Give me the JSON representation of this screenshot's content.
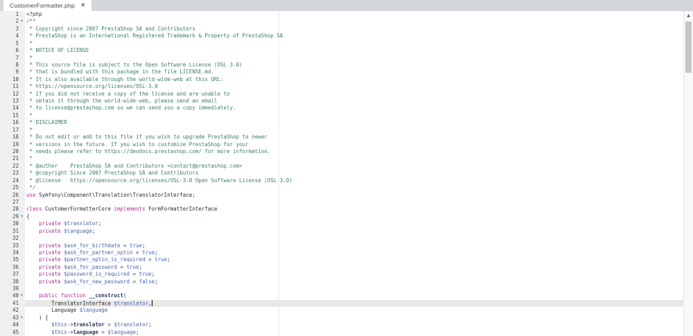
{
  "tab": {
    "title": "CustomerFormatter.php",
    "close_label": "×"
  },
  "editor": {
    "colors": {
      "tabbarBg": "#d3d6da",
      "gutterText": "#3d434d",
      "plain": "#303338",
      "comment": "#3a7f5c",
      "keyword": "#b02e8c",
      "variable": "#4d62a8",
      "constant": "#3f66d4",
      "identifier": "#26292e",
      "member": "#2a3a55"
    },
    "scrollbar_arrow": "▲",
    "lines": [
      {
        "n": 1,
        "tokens": [
          [
            "pl",
            "<?php"
          ]
        ]
      },
      {
        "n": 2,
        "fold": true,
        "tokens": [
          [
            "cm",
            "/**"
          ]
        ]
      },
      {
        "n": 3,
        "tokens": [
          [
            "cm",
            " * Copyright since 2007 PrestaShop SA and Contributors"
          ]
        ]
      },
      {
        "n": 4,
        "tokens": [
          [
            "cm",
            " * PrestaShop is an International Registered Trademark & Property of PrestaShop SA"
          ]
        ]
      },
      {
        "n": 5,
        "tokens": [
          [
            "cm",
            " *"
          ]
        ]
      },
      {
        "n": 6,
        "tokens": [
          [
            "cm",
            " * NOTICE OF LICENSE"
          ]
        ]
      },
      {
        "n": 7,
        "tokens": [
          [
            "cm",
            " *"
          ]
        ]
      },
      {
        "n": 8,
        "tokens": [
          [
            "cm",
            " * This source file is subject to the Open Software License (OSL 3.0)"
          ]
        ]
      },
      {
        "n": 9,
        "tokens": [
          [
            "cm",
            " * that is bundled with this package in the file LICENSE.md."
          ]
        ]
      },
      {
        "n": 10,
        "tokens": [
          [
            "cm",
            " * It is also available through the world-wide-web at this URL:"
          ]
        ]
      },
      {
        "n": 11,
        "tokens": [
          [
            "cm",
            " * https://opensource.org/licenses/OSL-3.0"
          ]
        ]
      },
      {
        "n": 12,
        "tokens": [
          [
            "cm",
            " * If you did not receive a copy of the license and are unable to"
          ]
        ]
      },
      {
        "n": 13,
        "tokens": [
          [
            "cm",
            " * obtain it through the world-wide-web, please send an email"
          ]
        ]
      },
      {
        "n": 14,
        "tokens": [
          [
            "cm",
            " * to license@prestashop.com so we can send you a copy immediately."
          ]
        ]
      },
      {
        "n": 15,
        "tokens": [
          [
            "cm",
            " *"
          ]
        ]
      },
      {
        "n": 16,
        "tokens": [
          [
            "cm",
            " * DISCLAIMER"
          ]
        ]
      },
      {
        "n": 17,
        "tokens": [
          [
            "cm",
            " *"
          ]
        ]
      },
      {
        "n": 18,
        "tokens": [
          [
            "cm",
            " * Do not edit or add to this file if you wish to upgrade PrestaShop to newer"
          ]
        ]
      },
      {
        "n": 19,
        "tokens": [
          [
            "cm",
            " * versions in the future. If you wish to customize PrestaShop for your"
          ]
        ]
      },
      {
        "n": 20,
        "tokens": [
          [
            "cm",
            " * needs please refer to https://devdocs.prestashop.com/ for more information."
          ]
        ]
      },
      {
        "n": 21,
        "tokens": [
          [
            "cm",
            " *"
          ]
        ]
      },
      {
        "n": 22,
        "tokens": [
          [
            "cm",
            " * @author    PrestaShop SA and Contributors <contact@prestashop.com>"
          ]
        ]
      },
      {
        "n": 23,
        "tokens": [
          [
            "cm",
            " * @copyright Since 2007 PrestaShop SA and Contributors"
          ]
        ]
      },
      {
        "n": 24,
        "tokens": [
          [
            "cm",
            " * @license   https://opensource.org/licenses/OSL-3.0 Open Software License (OSL 3.0)"
          ]
        ]
      },
      {
        "n": 25,
        "tokens": [
          [
            "cm",
            " */"
          ]
        ]
      },
      {
        "n": 26,
        "tokens": [
          [
            "kw",
            "use"
          ],
          [
            "pl",
            " "
          ],
          [
            "id",
            "Symfony\\Component\\Translation\\TranslatorInterface"
          ],
          [
            "pl",
            ";"
          ]
        ]
      },
      {
        "n": 27,
        "tokens": []
      },
      {
        "n": 28,
        "tokens": [
          [
            "kw",
            "class"
          ],
          [
            "pl",
            " "
          ],
          [
            "id",
            "CustomerFormatterCore"
          ],
          [
            "pl",
            " "
          ],
          [
            "kw",
            "implements"
          ],
          [
            "pl",
            " "
          ],
          [
            "id",
            "FormFormatterInterface"
          ]
        ]
      },
      {
        "n": 29,
        "fold": true,
        "tokens": [
          [
            "pl",
            "{"
          ]
        ]
      },
      {
        "n": 30,
        "tokens": [
          [
            "pl",
            "    "
          ],
          [
            "kw",
            "private"
          ],
          [
            "pl",
            " "
          ],
          [
            "vr",
            "$translator"
          ],
          [
            "pl",
            ";"
          ]
        ]
      },
      {
        "n": 31,
        "tokens": [
          [
            "pl",
            "    "
          ],
          [
            "kw",
            "private"
          ],
          [
            "pl",
            " "
          ],
          [
            "vr",
            "$language"
          ],
          [
            "pl",
            ";"
          ]
        ]
      },
      {
        "n": 32,
        "tokens": []
      },
      {
        "n": 33,
        "tokens": [
          [
            "pl",
            "    "
          ],
          [
            "kw",
            "private"
          ],
          [
            "pl",
            " "
          ],
          [
            "vr",
            "$ask_for_birthdate"
          ],
          [
            "pl",
            " = "
          ],
          [
            "ct",
            "true"
          ],
          [
            "pl",
            ";"
          ]
        ]
      },
      {
        "n": 34,
        "tokens": [
          [
            "pl",
            "    "
          ],
          [
            "kw",
            "private"
          ],
          [
            "pl",
            " "
          ],
          [
            "vr",
            "$ask_for_partner_optin"
          ],
          [
            "pl",
            " = "
          ],
          [
            "ct",
            "true"
          ],
          [
            "pl",
            ";"
          ]
        ]
      },
      {
        "n": 35,
        "tokens": [
          [
            "pl",
            "    "
          ],
          [
            "kw",
            "private"
          ],
          [
            "pl",
            " "
          ],
          [
            "vr",
            "$partner_optin_is_required"
          ],
          [
            "pl",
            " = "
          ],
          [
            "ct",
            "true"
          ],
          [
            "pl",
            ";"
          ]
        ]
      },
      {
        "n": 36,
        "tokens": [
          [
            "pl",
            "    "
          ],
          [
            "kw",
            "private"
          ],
          [
            "pl",
            " "
          ],
          [
            "vr",
            "$ask_for_password"
          ],
          [
            "pl",
            " = "
          ],
          [
            "ct",
            "true"
          ],
          [
            "pl",
            ";"
          ]
        ]
      },
      {
        "n": 37,
        "tokens": [
          [
            "pl",
            "    "
          ],
          [
            "kw",
            "private"
          ],
          [
            "pl",
            " "
          ],
          [
            "vr",
            "$password_is_required"
          ],
          [
            "pl",
            " = "
          ],
          [
            "ct",
            "true"
          ],
          [
            "pl",
            ";"
          ]
        ]
      },
      {
        "n": 38,
        "tokens": [
          [
            "pl",
            "    "
          ],
          [
            "kw",
            "private"
          ],
          [
            "pl",
            " "
          ],
          [
            "vr",
            "$ask_for_new_password"
          ],
          [
            "pl",
            " = "
          ],
          [
            "ct",
            "false"
          ],
          [
            "pl",
            ";"
          ]
        ]
      },
      {
        "n": 39,
        "tokens": []
      },
      {
        "n": 40,
        "fold": true,
        "tokens": [
          [
            "pl",
            "    "
          ],
          [
            "kw",
            "public"
          ],
          [
            "pl",
            " "
          ],
          [
            "kw",
            "function"
          ],
          [
            "pl",
            " "
          ],
          [
            "fn",
            "__construct"
          ],
          [
            "pl",
            "("
          ]
        ]
      },
      {
        "n": 41,
        "cur": true,
        "cursor": true,
        "tokens": [
          [
            "pl",
            "        "
          ],
          [
            "id",
            "TranslatorInterface"
          ],
          [
            "pl",
            " "
          ],
          [
            "vr",
            "$translator"
          ],
          [
            "pl",
            ","
          ]
        ]
      },
      {
        "n": 42,
        "tokens": [
          [
            "pl",
            "        "
          ],
          [
            "id",
            "Language"
          ],
          [
            "pl",
            " "
          ],
          [
            "vr",
            "$language"
          ]
        ]
      },
      {
        "n": 43,
        "fold": true,
        "tokens": [
          [
            "pl",
            "    ) {"
          ]
        ]
      },
      {
        "n": 44,
        "tokens": [
          [
            "pl",
            "        "
          ],
          [
            "vr",
            "$this"
          ],
          [
            "op",
            "->"
          ],
          [
            "fn",
            "translator"
          ],
          [
            "pl",
            " "
          ],
          [
            "op",
            "="
          ],
          [
            "pl",
            " "
          ],
          [
            "vr",
            "$translator"
          ],
          [
            "pl",
            ";"
          ]
        ]
      },
      {
        "n": 45,
        "tokens": [
          [
            "pl",
            "        "
          ],
          [
            "vr",
            "$this"
          ],
          [
            "op",
            "->"
          ],
          [
            "fn",
            "language"
          ],
          [
            "pl",
            " "
          ],
          [
            "op",
            "="
          ],
          [
            "pl",
            " "
          ],
          [
            "vr",
            "$language"
          ],
          [
            "pl",
            ";"
          ]
        ]
      }
    ]
  }
}
